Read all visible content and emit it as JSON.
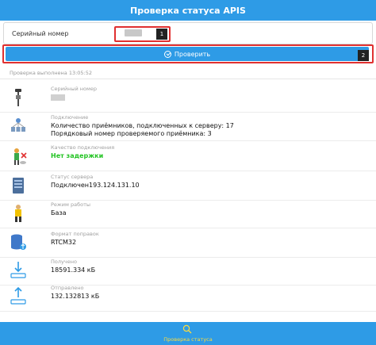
{
  "header": {
    "title": "Проверка статуса APIS"
  },
  "serial": {
    "label": "Серийный номер"
  },
  "markers": {
    "m1": "1",
    "m2": "2"
  },
  "check_button": {
    "label": "Проверить"
  },
  "checked_time": "Проверка выполнена 13:05:52",
  "rows": [
    {
      "icon": "receiver-pole-icon",
      "label": "Серийный номер",
      "value": ""
    },
    {
      "icon": "satellite-receivers-icon",
      "label": "Подключение",
      "value": "Количество приёмников, подключенных к серверу: 17",
      "value2": "Порядковый номер проверяемого приёмника: 3"
    },
    {
      "icon": "quality-worker-icon",
      "label": "Качество подключения",
      "value": "Нет задержки"
    },
    {
      "icon": "server-icon",
      "label": "Статус сервера",
      "value": "Подключен193.124.131.10"
    },
    {
      "icon": "surveyor-icon",
      "label": "Режим работы",
      "value": "База"
    },
    {
      "icon": "database-upload-icon",
      "label": "Формат поправок",
      "value": "RTCM32"
    },
    {
      "icon": "download-arrow-icon",
      "label": "Получено",
      "value": "18591.334 кБ"
    },
    {
      "icon": "upload-arrow-icon",
      "label": "Отправлено",
      "value": "132.132813 кБ"
    }
  ],
  "footer": {
    "label": "Проверка статуса"
  },
  "colors": {
    "accent": "#2e9be6",
    "marker": "#e03030",
    "ok": "#22c322",
    "footer_text": "#ffdb3a"
  }
}
